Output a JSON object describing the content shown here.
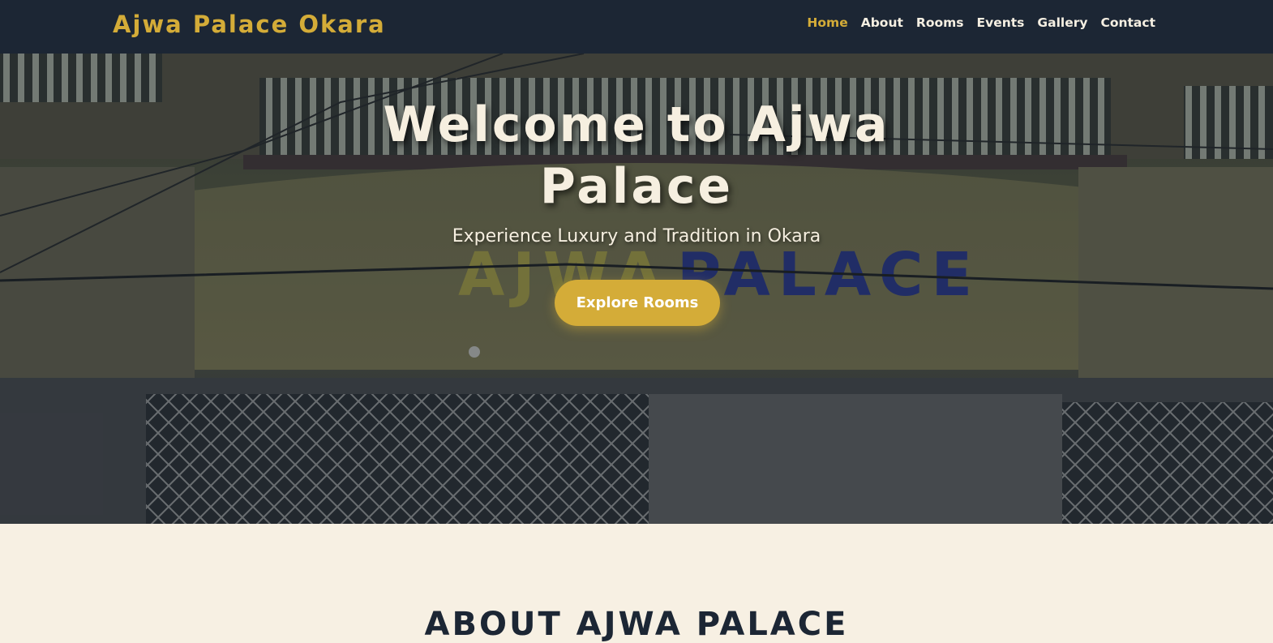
{
  "nav": {
    "brand": "Ajwa Palace Okara",
    "links": [
      "Home",
      "About",
      "Rooms",
      "Events",
      "Gallery",
      "Contact"
    ],
    "active": "Home"
  },
  "hero": {
    "title": "Welcome to Ajwa Palace",
    "subtitle": "Experience Luxury and Tradition in Okara",
    "button": "Explore Rooms",
    "sign_text_left": "AJWA",
    "sign_text_right": "PALACE"
  },
  "about": {
    "title": "ABOUT AJWA PALACE"
  },
  "colors": {
    "navbar": "#1c2634",
    "accent": "#d4ac38",
    "cream": "#f7f0e3"
  }
}
